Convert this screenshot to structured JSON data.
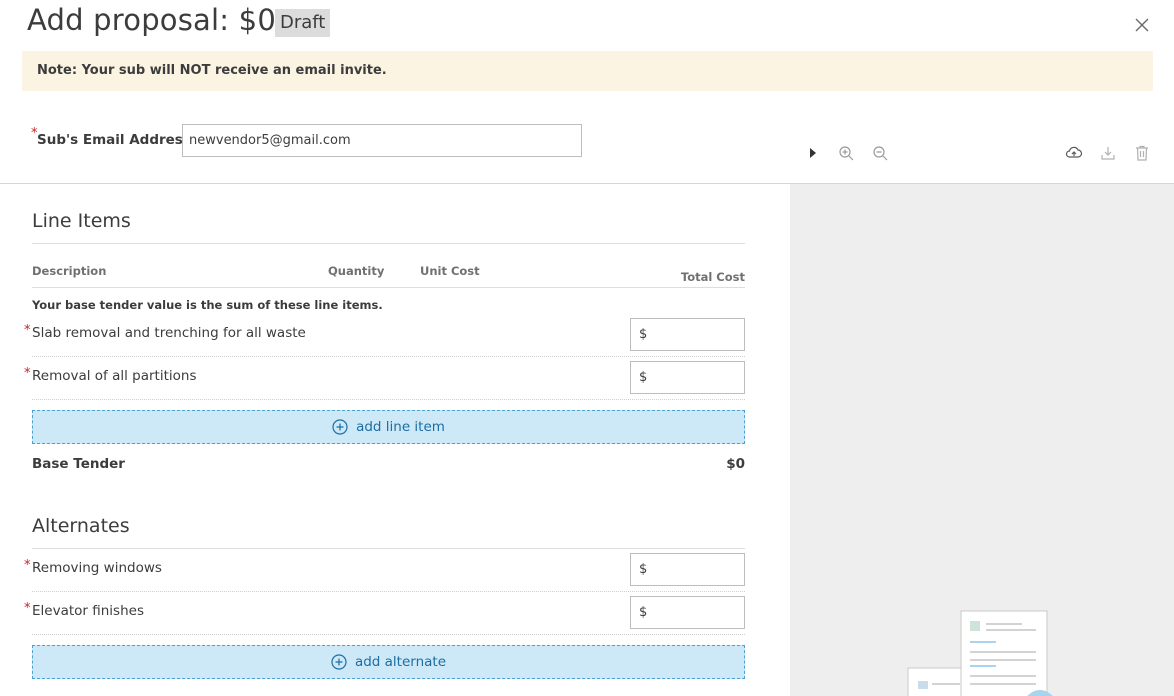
{
  "header": {
    "title": "Add proposal: $0",
    "status_badge": "Draft"
  },
  "note": "Note: Your sub will NOT receive an email invite.",
  "email": {
    "label": "Sub's Email Address",
    "value": "newvendor5@gmail.com",
    "required_mark": "*"
  },
  "viewer_toolbar": {
    "icons": [
      "play-icon",
      "zoom-in-icon",
      "zoom-out-icon",
      "upload-icon",
      "download-icon",
      "trash-icon"
    ]
  },
  "line_items": {
    "title": "Line Items",
    "columns": [
      "Description",
      "Quantity",
      "Unit Cost",
      "Total Cost"
    ],
    "hint": "Your base tender value is the sum of these line items.",
    "rows": [
      {
        "label": "Slab removal and trenching for all waste",
        "currency": "$"
      },
      {
        "label": "Removal of all partitions",
        "currency": "$"
      }
    ],
    "add_label": "add line item",
    "base_label": "Base Tender",
    "base_value": "$0"
  },
  "alternates": {
    "title": "Alternates",
    "rows": [
      {
        "label": "Removing windows",
        "currency": "$"
      },
      {
        "label": "Elevator finishes",
        "currency": "$"
      }
    ],
    "add_label": "add alternate"
  },
  "colors": {
    "accent": "#1c6ea4",
    "add_button_bg": "#cde8f6",
    "note_bg": "#fbf4e3",
    "required": "#c81e1e"
  }
}
